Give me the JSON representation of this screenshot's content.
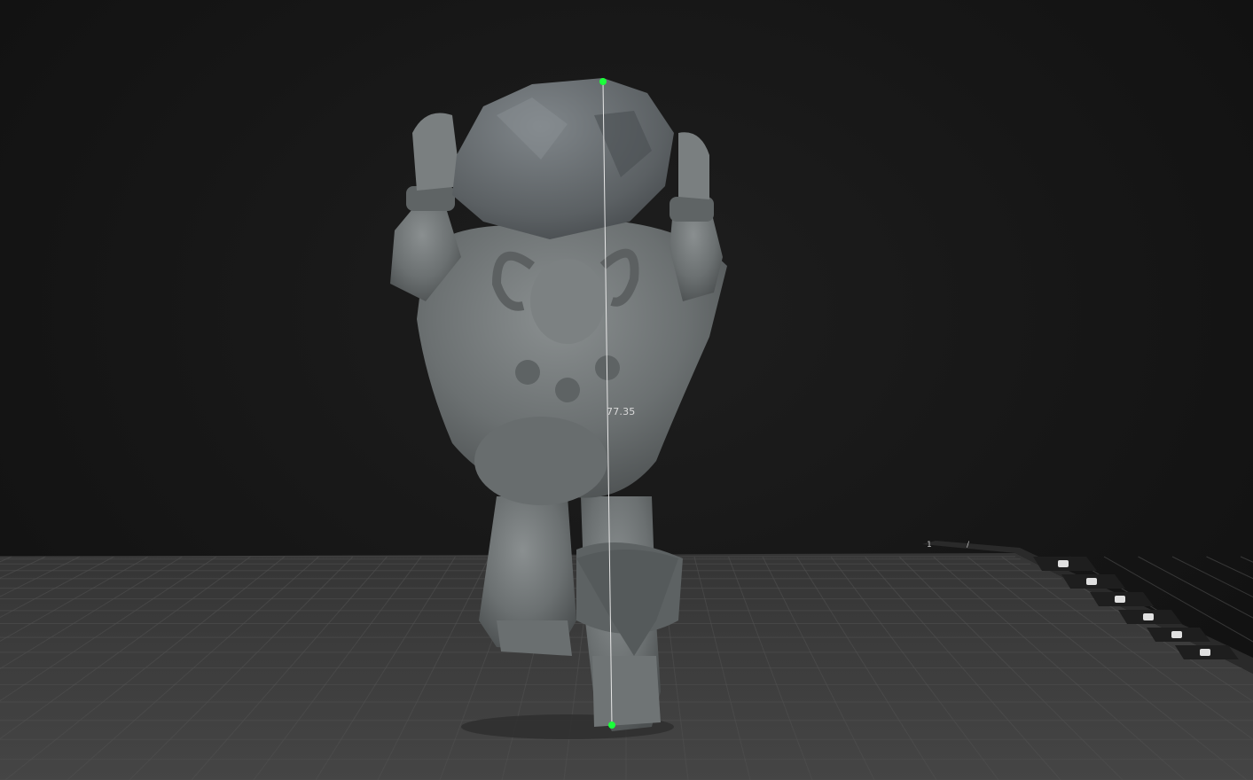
{
  "viewport": {
    "measurement": {
      "value_label": "77.35"
    },
    "build_plate": {
      "corner_labels": [
        "1",
        "/"
      ]
    },
    "model_name": "",
    "colors": {
      "background": "#131313",
      "grid_plate": "#3c3c3c",
      "grid_lines": "#555555",
      "model": "#6f7475",
      "measure_point": "#1aff3a",
      "measure_line": "#e8e8e8"
    },
    "side_tools": [
      {
        "icon": "scissors-icon"
      },
      {
        "icon": "camera-icon"
      },
      {
        "icon": "screen-icon"
      },
      {
        "icon": "folder-icon"
      },
      {
        "icon": "lock-icon"
      },
      {
        "icon": "axis-icon"
      }
    ]
  }
}
